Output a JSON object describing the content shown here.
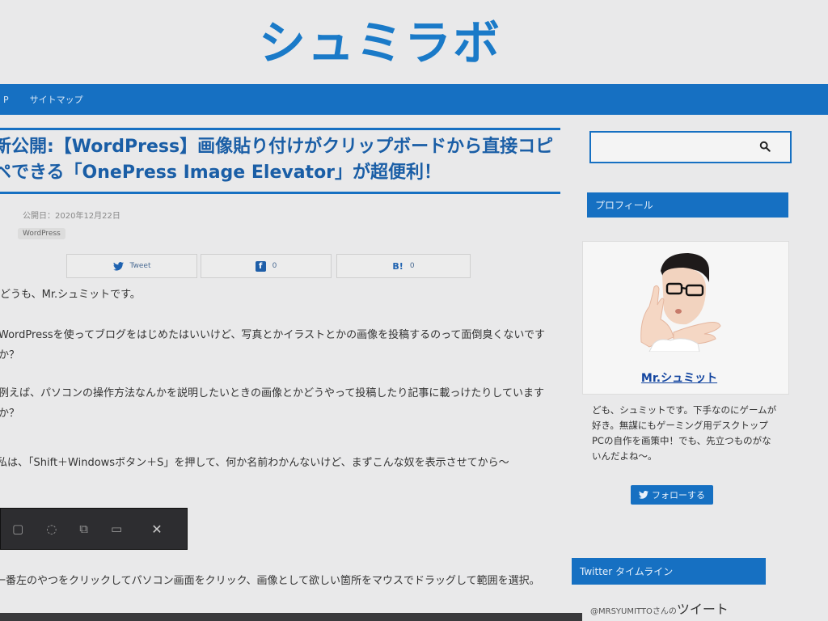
{
  "site": {
    "logo_text": "シュミラボ"
  },
  "nav": {
    "items": [
      "P",
      "サイトマップ"
    ]
  },
  "article": {
    "title": "新公開:【WordPress】画像貼り付けがクリップボードから直接コピペできる「OnePress Image Elevator」が超便利！",
    "meta": "公開日：2020年12月22日",
    "tag": "WordPress",
    "share": {
      "tweet_label": "Tweet",
      "facebook_count": "0",
      "hatena_label": "B!",
      "hatena_count": "0"
    },
    "paragraphs": [
      "どうも、Mr.シュミットです。",
      "WordPressを使ってブログをはじめたはいいけど、写真とかイラストとかの画像を投稿するのって面倒臭くないですか？",
      "例えば、パソコンの操作方法なんかを説明したいときの画像とかどうやって投稿したり記事に載っけたりしていますか？",
      "私は、「Shift＋Windowsボタン＋S」を押して、何か名前わかんないけど、まずこんな奴を表示させてから〜",
      "一番左のやつをクリックしてパソコン画面をクリック、画像として欲しい箇所をマウスでドラッグして範囲を選択。"
    ],
    "toolbar_icons": [
      "rect-snip-icon",
      "freeform-snip-icon",
      "window-snip-icon",
      "fullscreen-snip-icon",
      "close-icon"
    ]
  },
  "sidebar": {
    "search_placeholder": "",
    "profile_heading": "プロフィール",
    "profile_name": "Mr.シュミット",
    "profile_text": "ども、シュミットです。下手なのにゲームが好き。無謀にもゲーミング用デスクトップPCの自作を画策中！でも、先立つものがないんだよね〜。",
    "follow_label": "フォローする",
    "twitter_heading": "Twitter タイムライン",
    "timeline_prefix": "@MRSYUMITTOさんの",
    "timeline_big": "ツイート"
  },
  "colors": {
    "brand_blue": "#1670c2",
    "title_blue": "#1a5ea6"
  }
}
